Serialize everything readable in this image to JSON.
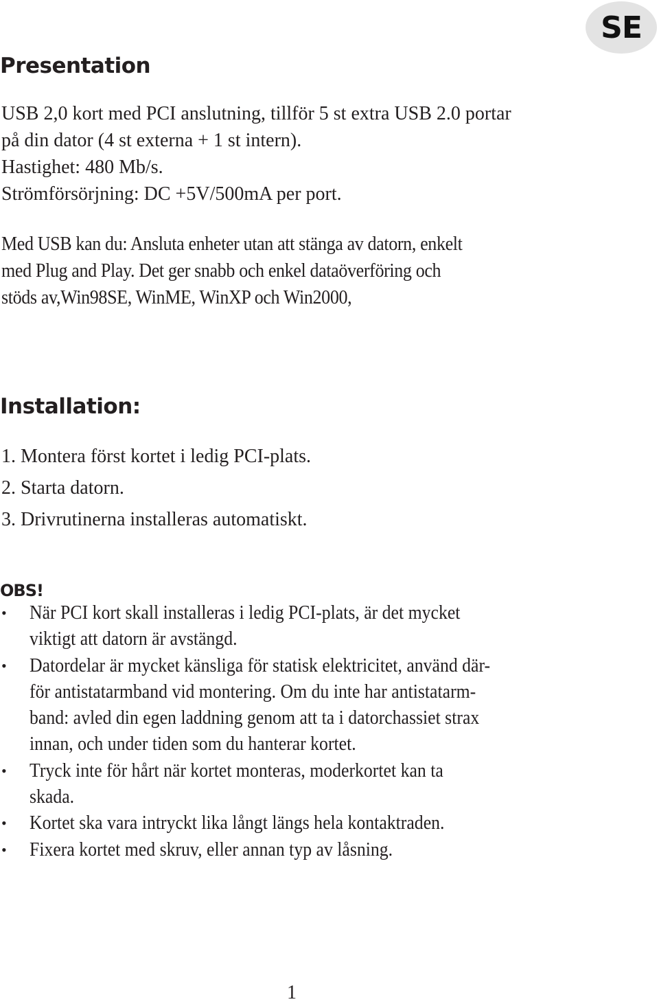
{
  "language_badge": "SE",
  "sections": {
    "presentation": {
      "title": "Presentation",
      "intro_lines": [
        "USB 2,0 kort med PCI anslutning, tillför 5 st extra USB 2.0 portar",
        "på din dator (4 st externa + 1 st intern).",
        "Hastighet: 480 Mb/s.",
        "Strömförsörjning: DC +5V/500mA per port."
      ],
      "usb_lines": [
        "Med USB kan du: Ansluta enheter utan att stänga av datorn, enkelt",
        "med Plug and Play. Det ger snabb och enkel dataöverföring och",
        "stöds av,Win98SE, WinME, WinXP och Win2000,"
      ]
    },
    "installation": {
      "title": "Installation:",
      "steps": [
        "1. Montera först kortet i ledig PCI-plats.",
        "2. Starta datorn.",
        "3. Drivrutinerna installeras automatiskt."
      ]
    },
    "obs": {
      "title": "OBS!",
      "bullet_symbol": "•",
      "bullets": [
        {
          "lines": [
            "När PCI kort skall installeras i ledig PCI-plats, är det mycket",
            "viktigt att datorn är avstängd."
          ]
        },
        {
          "lines": [
            "Datordelar är mycket känsliga för statisk elektricitet, använd där-",
            "för antistatarmband vid montering. Om du inte har antistatarm-",
            "band: avled din egen laddning genom att ta i datorchassiet strax",
            "innan, och under tiden som du hanterar kortet."
          ]
        },
        {
          "lines": [
            "Tryck inte för hårt när kortet monteras, moderkortet kan ta",
            "skada."
          ]
        },
        {
          "lines": [
            "Kortet ska vara intryckt lika långt längs hela kontaktraden."
          ]
        },
        {
          "lines": [
            "Fixera kortet med skruv, eller annan typ av låsning."
          ]
        }
      ]
    }
  },
  "page_number": "1"
}
